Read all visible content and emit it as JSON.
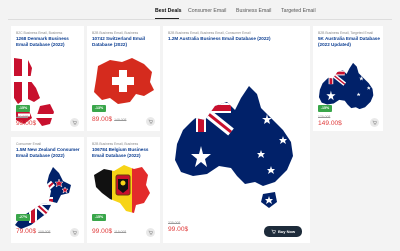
{
  "tabs": [
    {
      "label": "Best Deals",
      "active": true
    },
    {
      "label": "Consumer Email",
      "active": false
    },
    {
      "label": "Business Email",
      "active": false
    },
    {
      "label": "Targeted Email",
      "active": false
    }
  ],
  "products": [
    {
      "category": "B2C Business Email, Business",
      "title": "1268 Denmark Business Email Database (2022)",
      "badge": "-15%",
      "old_price": "119.00$",
      "price": "99.00$",
      "flag": "denmark-map"
    },
    {
      "category": "B2B Business Email, Business",
      "title": "10742 Switzerland Email Database (2022)",
      "badge": "-13%",
      "old_price": "149.00$",
      "price": "89.00$",
      "flag": "switzerland-map"
    },
    {
      "category": "B2B Business Email, Business Email, Consumer Email",
      "title": "1.2M Australia Business Email Database (2022)",
      "old_price": "329.00$",
      "price": "99.00$",
      "buy_label": "Buy Now",
      "flag": "australia-map"
    },
    {
      "category": "B2B Business Email, Targeted Email",
      "title": "5K Australia Email Database (2022 Updated)",
      "badge": "-15%",
      "old_price": "179.00$",
      "price": "149.00$",
      "flag": "australia-small-map"
    },
    {
      "category": "Consumer Email",
      "title": "1.5M New Zealand Consumer Email Database (2022)",
      "badge": "-27%",
      "old_price": "109.00$",
      "price": "79.00$",
      "flag": "new-zealand-map"
    },
    {
      "category": "B2B Business Email, Business",
      "title": "106784 Belgium Business Email Database (2022)",
      "badge": "-15%",
      "old_price": "119.00$",
      "price": "99.00$",
      "flag": "belgium-map"
    }
  ],
  "colors": {
    "accent_green": "#39a64a",
    "price_red": "#e03a3a",
    "title_blue": "#0b3d91",
    "buy_dark": "#1d2b3a"
  }
}
